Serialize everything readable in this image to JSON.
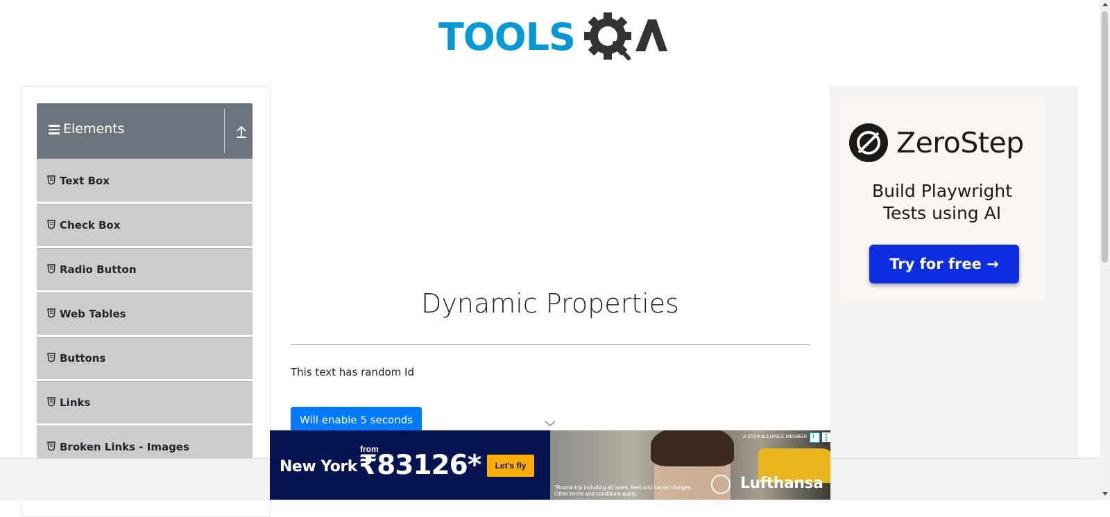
{
  "header": {
    "logo_text_left": "TOOLS",
    "logo_text_right": "QA"
  },
  "sidebar": {
    "group_title": "Elements",
    "items": [
      {
        "label": "Text Box"
      },
      {
        "label": "Check Box"
      },
      {
        "label": "Radio Button"
      },
      {
        "label": "Web Tables"
      },
      {
        "label": "Buttons"
      },
      {
        "label": "Links"
      },
      {
        "label": "Broken Links - Images"
      }
    ]
  },
  "main": {
    "title": "Dynamic Properties",
    "random_text": "This text has random Id",
    "enable_button_label": "Will enable 5 seconds"
  },
  "right_ad": {
    "brand": "ZeroStep",
    "tagline_line1": "Build Playwright",
    "tagline_line2": "Tests using AI",
    "cta_label": "Try for free →"
  },
  "bottom_ad": {
    "city": "New York",
    "from_label": "from",
    "price": "₹83126*",
    "cta_label": "Let's fly",
    "alliance": "A STAR ALLIANCE MEMBER",
    "brand": "Lufthansa",
    "fineprint_line1": "*Round-trip including all taxes, fees and carrier charges.",
    "fineprint_line2": "Other terms and conditions apply."
  },
  "colors": {
    "accent": "#007bff",
    "sidebar_header": "#6c757d",
    "menu_item_bg": "#cccccc",
    "logo_blue": "#0099d8",
    "zerostep_button": "#0d2de0",
    "lufthansa_navy": "#061451",
    "lufthansa_yellow": "#ffad00"
  }
}
